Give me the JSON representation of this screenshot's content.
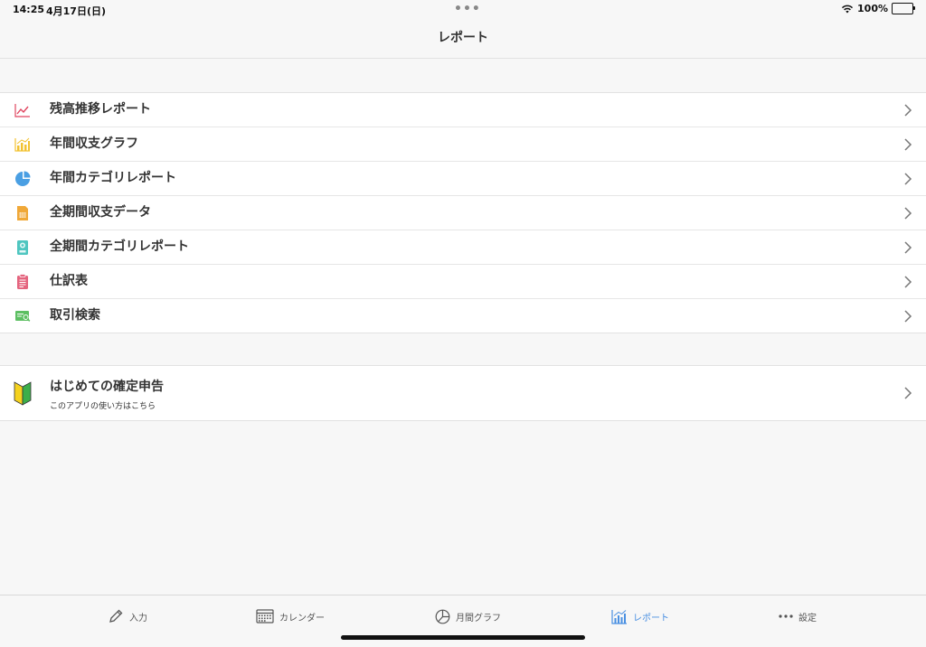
{
  "status": {
    "time": "14:25",
    "date": "4月17日(日)",
    "dots": "•••",
    "battery": "100%"
  },
  "nav": {
    "title": "レポート"
  },
  "menu": {
    "items": [
      {
        "label": "残高推移レポート",
        "icon": "line-chart-icon",
        "color": "#e0455f"
      },
      {
        "label": "年間収支グラフ",
        "icon": "bar-chart-icon",
        "color": "#f2c230"
      },
      {
        "label": "年間カテゴリレポート",
        "icon": "pie-chart-icon",
        "color": "#4a9fe3"
      },
      {
        "label": "全期間収支データ",
        "icon": "document-icon",
        "color": "#f0a838"
      },
      {
        "label": "全期間カテゴリレポート",
        "icon": "badge-icon",
        "color": "#4fc6c0"
      },
      {
        "label": "仕訳表",
        "icon": "clipboard-icon",
        "color": "#e4647e"
      },
      {
        "label": "取引検索",
        "icon": "search-card-icon",
        "color": "#5cbf62"
      }
    ]
  },
  "guide": {
    "label": "はじめての確定申告",
    "sub": "このアプリの使い方はこちら",
    "icon": "beginner-mark-icon"
  },
  "tabs": [
    {
      "label": "入力",
      "icon": "pencil-icon"
    },
    {
      "label": "カレンダー",
      "icon": "calendar-icon"
    },
    {
      "label": "月間グラフ",
      "icon": "pie-icon"
    },
    {
      "label": "レポート",
      "icon": "report-icon",
      "active": true
    },
    {
      "label": "設定",
      "icon": "more-icon"
    }
  ],
  "colors": {
    "accent": "#4a90e2",
    "background": "#f7f7f7"
  }
}
